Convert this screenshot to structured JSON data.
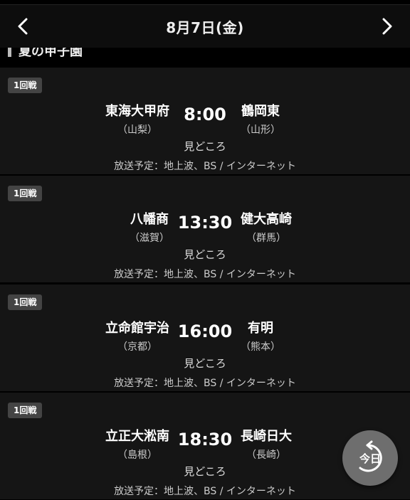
{
  "header": {
    "title": "8月7日(金)",
    "prev_icon": "chevron-left-icon",
    "next_icon": "chevron-right-icon"
  },
  "section": {
    "label": "夏の甲子園"
  },
  "games": [
    {
      "round": "1回戦",
      "home": {
        "name": "東海大甲府",
        "pref": "（山梨）"
      },
      "time": "8:00",
      "away": {
        "name": "鶴岡東",
        "pref": "（山形）"
      },
      "highlight": "見どころ",
      "broadcast": "放送予定：地上波、BS / インターネット"
    },
    {
      "round": "1回戦",
      "home": {
        "name": "八幡商",
        "pref": "（滋賀）"
      },
      "time": "13:30",
      "away": {
        "name": "健大高崎",
        "pref": "（群馬）"
      },
      "highlight": "見どころ",
      "broadcast": "放送予定：地上波、BS / インターネット"
    },
    {
      "round": "1回戦",
      "home": {
        "name": "立命館宇治",
        "pref": "（京都）"
      },
      "time": "16:00",
      "away": {
        "name": "有明",
        "pref": "（熊本）"
      },
      "highlight": "見どころ",
      "broadcast": "放送予定：地上波、BS / インターネット"
    },
    {
      "round": "1回戦",
      "home": {
        "name": "立正大淞南",
        "pref": "（島根）"
      },
      "time": "18:30",
      "away": {
        "name": "長崎日大",
        "pref": "（長崎）"
      },
      "highlight": "見どころ",
      "broadcast": "放送予定：地上波、BS / インターネット"
    }
  ],
  "today_button": {
    "label": "今日",
    "icon": "return-arrow-icon"
  }
}
